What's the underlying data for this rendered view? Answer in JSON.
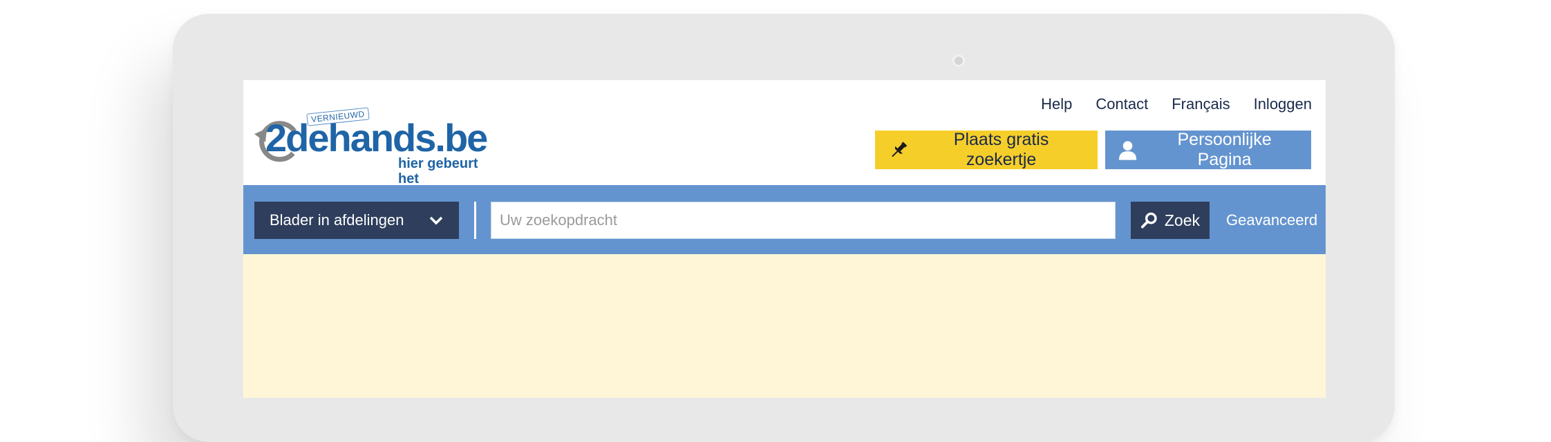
{
  "logo": {
    "name": "2dehands.be",
    "tagline": "hier gebeurt het",
    "badge": "VERNIEUWD",
    "color": "#1f64a6"
  },
  "top_links": [
    "Help",
    "Contact",
    "Français",
    "Inloggen"
  ],
  "buttons": {
    "place_ad": {
      "label": "Plaats gratis zoekertje",
      "icon": "pushpin-icon",
      "color": "#f6ce2a"
    },
    "personal": {
      "label": "Persoonlijke Pagina",
      "icon": "user-icon",
      "color": "#6494cf"
    }
  },
  "search": {
    "departments_label": "Blader in afdelingen",
    "placeholder": "Uw zoekopdracht",
    "submit_label": "Zoek",
    "advanced_label": "Geavanceerd",
    "bar_color": "#6494cf",
    "dark_color": "#2e3e5c"
  },
  "content": {
    "background": "#fef6d7"
  }
}
